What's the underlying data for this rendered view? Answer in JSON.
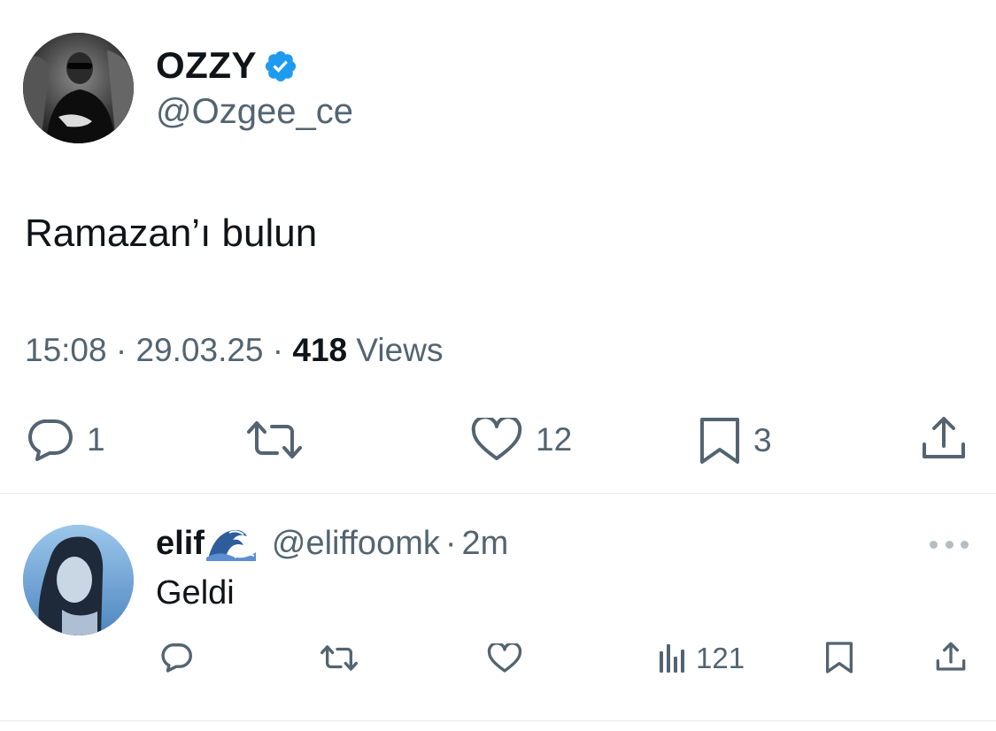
{
  "tweet": {
    "author_name": "OZZY",
    "author_handle": "@Ozgee_ce",
    "text": "Ramazan’ı bulun",
    "time": "15:08",
    "date": "29.03.25",
    "separator": "·",
    "views_count": "418",
    "views_label": "Views",
    "actions": {
      "replies": "1",
      "likes": "12",
      "bookmarks": "3"
    }
  },
  "reply": {
    "author_name": "elif",
    "author_handle": "@eliffoomk",
    "separator": "·",
    "time": "2m",
    "text": "Geldi",
    "views": "121"
  },
  "colors": {
    "text_primary": "#0f1419",
    "text_secondary": "#536471",
    "verified_blue": "#1d9bf0",
    "divider": "#e6e9eb"
  },
  "icons": [
    "verified-badge-icon",
    "reply-icon",
    "retweet-icon",
    "like-icon",
    "bookmark-icon",
    "share-icon",
    "views-icon",
    "more-icon",
    "wave-emoji"
  ]
}
